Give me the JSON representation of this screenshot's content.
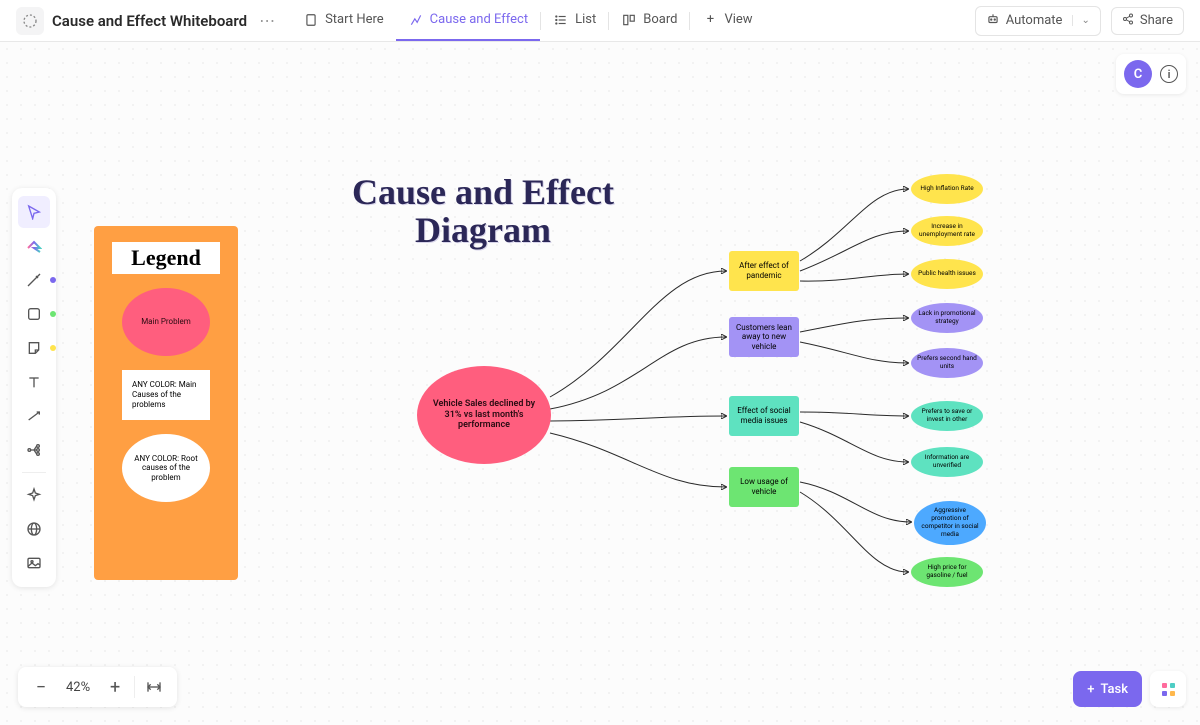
{
  "header": {
    "title": "Cause and Effect Whiteboard",
    "tabs": {
      "start": "Start Here",
      "diagram": "Cause and Effect",
      "list": "List",
      "board": "Board",
      "view": "View"
    },
    "automate": "Automate",
    "share": "Share"
  },
  "avatar": {
    "initial": "C"
  },
  "zoom": {
    "value": "42%"
  },
  "task_btn": "Task",
  "legend": {
    "title": "Legend",
    "main": "Main Problem",
    "causes_label": "ANY COLOR: Main Causes of the problems",
    "root_label": "ANY COLOR: Root causes of the problem"
  },
  "diagram": {
    "title": "Cause and Effect Diagram",
    "main_problem": "Vehicle Sales declined by 31% vs last month's performance",
    "causes": {
      "c1": "After effect of pandemic",
      "c2": "Customers lean away to new vehicle",
      "c3": "Effect of social media issues",
      "c4": "Low usage of vehicle"
    },
    "leaves": {
      "l1": "High Inflation Rate",
      "l2": "Increase in unemployment rate",
      "l3": "Public health issues",
      "l4": "Lack in promotional strategy",
      "l5": "Prefers second hand units",
      "l6": "Prefers to save or invest in other",
      "l7": "Information are unverified",
      "l8": "Aggressive promotion of competitor in social media",
      "l9": "High price for gasoline / fuel"
    }
  },
  "colors": {
    "accent": "#7b68ee",
    "red": "#ff5e7e",
    "orange": "#ff9f43",
    "yellow": "#ffe44d",
    "purple": "#a393f5",
    "teal": "#5ee2c0",
    "green": "#6de572",
    "blue": "#4da9ff"
  }
}
